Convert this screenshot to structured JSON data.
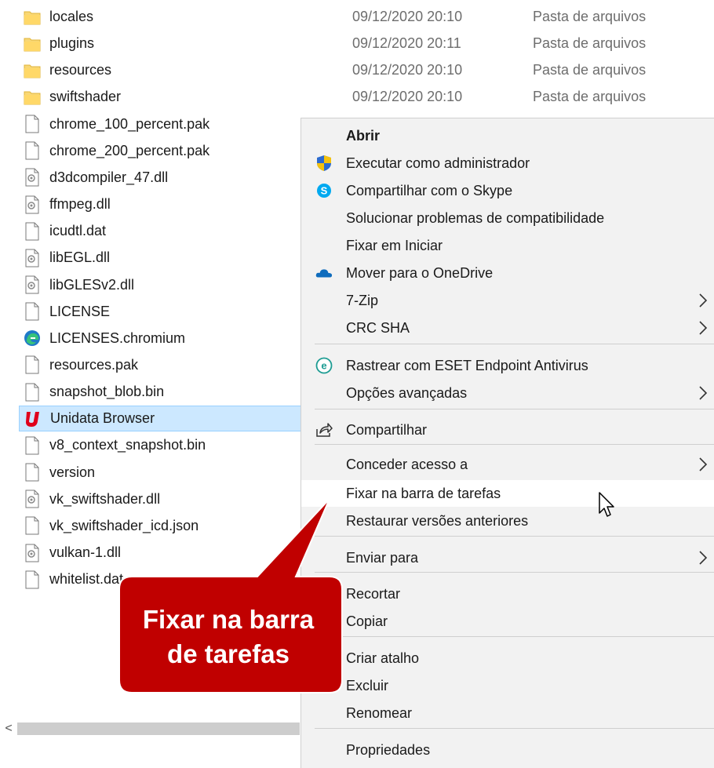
{
  "files": [
    {
      "name": "locales",
      "icon": "folder-icon",
      "date": "09/12/2020 20:10",
      "type": "Pasta de arquivos"
    },
    {
      "name": "plugins",
      "icon": "folder-icon",
      "date": "09/12/2020 20:11",
      "type": "Pasta de arquivos"
    },
    {
      "name": "resources",
      "icon": "folder-icon",
      "date": "09/12/2020 20:10",
      "type": "Pasta de arquivos"
    },
    {
      "name": "swiftshader",
      "icon": "folder-icon",
      "date": "09/12/2020 20:10",
      "type": "Pasta de arquivos"
    },
    {
      "name": "chrome_100_percent.pak",
      "icon": "file-icon"
    },
    {
      "name": "chrome_200_percent.pak",
      "icon": "file-icon"
    },
    {
      "name": "d3dcompiler_47.dll",
      "icon": "dll-icon"
    },
    {
      "name": "ffmpeg.dll",
      "icon": "dll-icon"
    },
    {
      "name": "icudtl.dat",
      "icon": "file-icon"
    },
    {
      "name": "libEGL.dll",
      "icon": "dll-icon"
    },
    {
      "name": "libGLESv2.dll",
      "icon": "dll-icon"
    },
    {
      "name": "LICENSE",
      "icon": "file-icon"
    },
    {
      "name": "LICENSES.chromium",
      "icon": "edge-icon"
    },
    {
      "name": "resources.pak",
      "icon": "file-icon"
    },
    {
      "name": "snapshot_blob.bin",
      "icon": "file-icon"
    },
    {
      "name": "Unidata Browser",
      "icon": "unidata-icon",
      "selected": true
    },
    {
      "name": "v8_context_snapshot.bin",
      "icon": "file-icon"
    },
    {
      "name": "version",
      "icon": "file-icon"
    },
    {
      "name": "vk_swiftshader.dll",
      "icon": "dll-icon"
    },
    {
      "name": "vk_swiftshader_icd.json",
      "icon": "file-icon"
    },
    {
      "name": "vulkan-1.dll",
      "icon": "dll-icon"
    },
    {
      "name": "whitelist.dat",
      "icon": "file-icon"
    }
  ],
  "context_menu": {
    "items": [
      {
        "label": "Abrir",
        "bold": true
      },
      {
        "label": "Executar como administrador",
        "icon": "uac-shield-icon"
      },
      {
        "label": "Compartilhar com o Skype",
        "icon": "skype-icon"
      },
      {
        "label": "Solucionar problemas de compatibilidade"
      },
      {
        "label": "Fixar em Iniciar"
      },
      {
        "label": "Mover para o OneDrive",
        "icon": "onedrive-icon"
      },
      {
        "label": "7-Zip",
        "submenu": true
      },
      {
        "label": "CRC SHA",
        "submenu": true
      },
      {
        "label": "Rastrear com ESET Endpoint Antivirus",
        "icon": "eset-icon"
      },
      {
        "label": "Opções avançadas",
        "submenu": true
      },
      {
        "label": "Compartilhar",
        "icon": "share-icon"
      },
      {
        "label": "Conceder acesso a",
        "submenu": true
      },
      {
        "label": "Fixar na barra de tarefas",
        "hover": true
      },
      {
        "label": "Restaurar versões anteriores"
      },
      {
        "label": "Enviar para",
        "submenu": true
      },
      {
        "label": "Recortar"
      },
      {
        "label": "Copiar"
      },
      {
        "label": "Criar atalho"
      },
      {
        "label": "Excluir"
      },
      {
        "label": "Renomear"
      },
      {
        "label": "Propriedades"
      }
    ]
  },
  "callout": {
    "text_line1": "Fixar na barra",
    "text_line2": "de tarefas",
    "color": "#c00000"
  },
  "scrollbar": {
    "left_arrow": "<"
  }
}
